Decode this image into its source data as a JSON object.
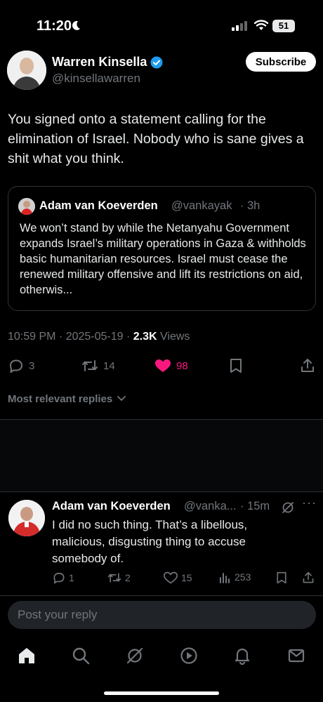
{
  "status_bar": {
    "time": "11:20",
    "battery": "51"
  },
  "author": {
    "name": "Warren Kinsella",
    "handle": "@kinsellawarren",
    "subscribe_label": "Subscribe"
  },
  "tweet": {
    "text": "You signed onto a statement calling for the elimination of Israel. Nobody who is sane gives a shit what you think."
  },
  "quote": {
    "name": "Adam van Koeverden",
    "handle": "@vankayak",
    "separator": "·",
    "time": "3h",
    "text": "We won’t stand by while the Netanyahu Government expands Israel’s military operations in Gaza & withholds basic humanitarian resources. Israel must cease the renewed military offensive and lift its restrictions on aid, otherwis..."
  },
  "meta": {
    "time": "10:59 PM",
    "date": "2025-05-19",
    "separator": " · ",
    "views_count": "2.3K",
    "views_label": "Views"
  },
  "actions": {
    "replies": "3",
    "reposts": "14",
    "likes": "98"
  },
  "replies_filter": {
    "label": "Most relevant replies"
  },
  "reply": {
    "name": "Adam van Koeverden",
    "handle": "@vanka...",
    "time": "· 15m",
    "more": "···",
    "text": "I did no such thing. That’s a libellous, malicious, disgusting thing to accuse somebody of.",
    "replies": "1",
    "reposts": "2",
    "likes": "15",
    "views": "253"
  },
  "composer": {
    "placeholder": "Post your reply"
  },
  "colors": {
    "like_pink": "#f91880",
    "verified_blue": "#1d9bf0",
    "muted": "#71767b"
  },
  "nav": [
    "home-icon",
    "search-icon",
    "grok-icon",
    "video-icon",
    "notifications-icon",
    "messages-icon"
  ]
}
